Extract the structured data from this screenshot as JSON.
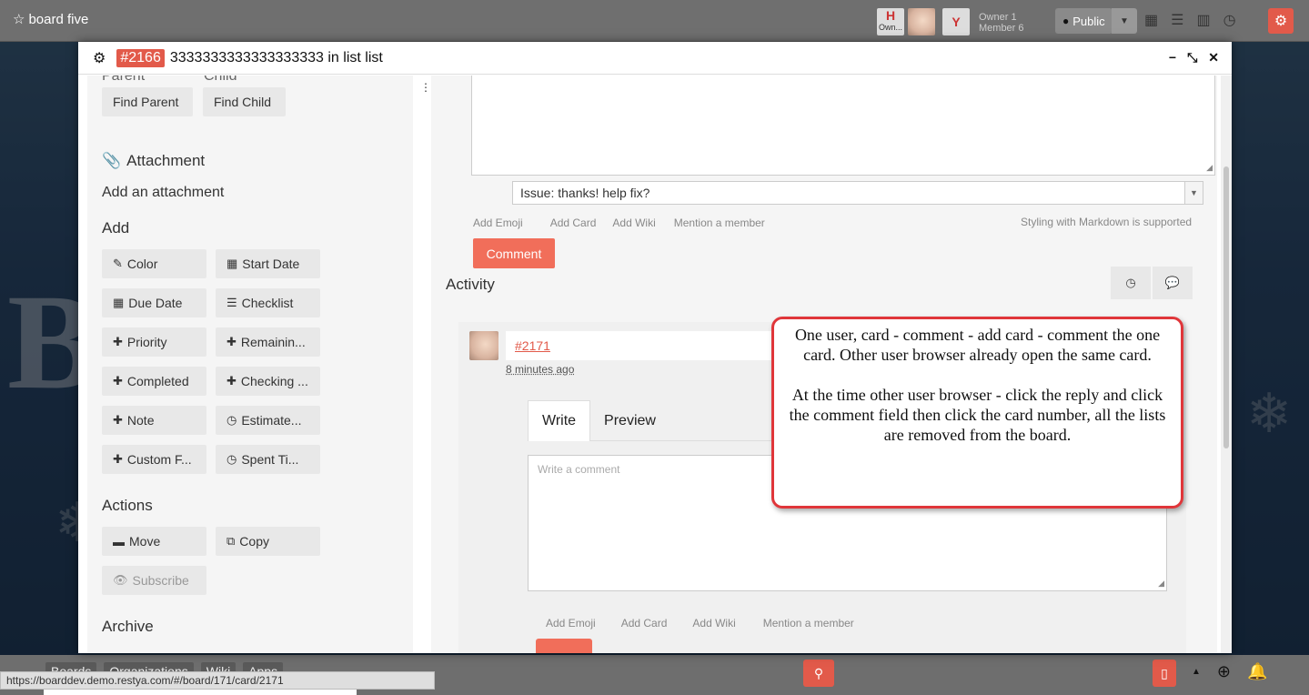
{
  "board": {
    "title": "board five",
    "owner_label": "Owner 1",
    "member_label": "Member 6",
    "avatar_initial_1": "H",
    "avatar_sub_1": "Own...",
    "avatar_initial_3": "Y",
    "visibility": "Public"
  },
  "modal": {
    "card_number": "#2166",
    "card_title": "3333333333333333333 in list list"
  },
  "left": {
    "parent_label": "Parent",
    "child_label": "Child",
    "find_parent": "Find Parent",
    "find_child": "Find Child",
    "attachment_title": "Attachment",
    "add_attachment": "Add an attachment",
    "add_title": "Add",
    "add_buttons": {
      "color": "Color",
      "start_date": "Start Date",
      "due_date": "Due Date",
      "checklist": "Checklist",
      "priority": "Priority",
      "remaining": "Remainin...",
      "completed": "Completed",
      "checking": "Checking ...",
      "note": "Note",
      "estimate": "Estimate...",
      "custom_field": "Custom F...",
      "spent_time": "Spent Ti..."
    },
    "actions_title": "Actions",
    "move": "Move",
    "copy": "Copy",
    "subscribe": "Subscribe",
    "archive_title": "Archive"
  },
  "right": {
    "template_select": "Issue: thanks! help fix?",
    "links": {
      "add_emoji": "Add Emoji",
      "add_card": "Add Card",
      "add_wiki": "Add Wiki",
      "mention": "Mention a member"
    },
    "markdown_note": "Styling with Markdown is supported",
    "comment_button": "Comment",
    "activity_title": "Activity",
    "activity_item": {
      "card_link": "#2171",
      "time": "8 minutes ago"
    },
    "tabs": {
      "write": "Write",
      "preview": "Preview"
    },
    "reply_placeholder": "Write a comment"
  },
  "callout": {
    "para1": "One user, card - comment - add card - comment the one card.  Other user browser already open the same card.",
    "para2": "At the time other user browser - click the reply and click the comment field then click the card number, all the lists are removed from the board."
  },
  "footer": {
    "boards": "Boards",
    "organizations": "Organizations",
    "wiki": "Wiki",
    "apps": "Apps",
    "status_url": "https://boarddev.demo.restya.com/#/board/171/card/2171"
  },
  "colors": {
    "accent": "#e25a4a",
    "callout_border": "#e0363a"
  }
}
